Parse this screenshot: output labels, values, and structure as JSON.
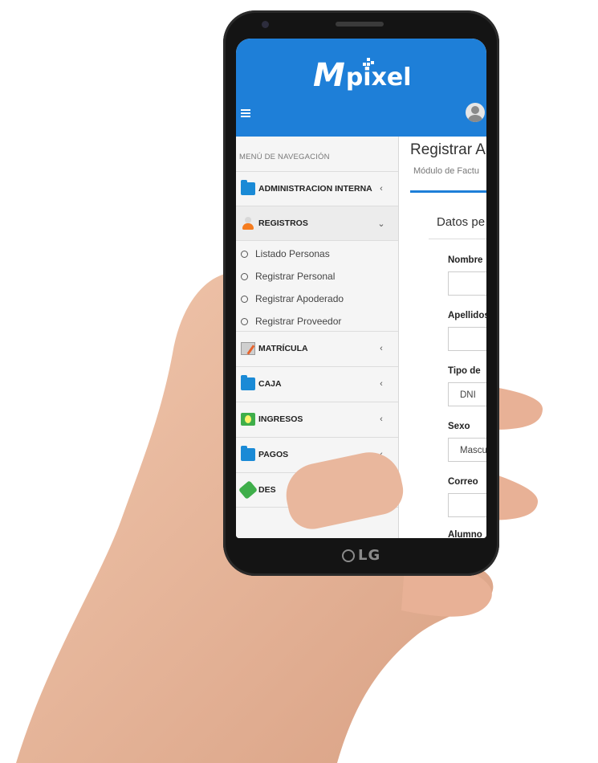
{
  "app": {
    "logo_m": "M",
    "logo_text": "pixel",
    "device_brand": "LG"
  },
  "sidebar": {
    "header": "MENÚ DE NAVEGACIÓN",
    "items": [
      {
        "label": "ADMINISTRACION INTERNA",
        "icon": "folder-icon",
        "chevron": "‹"
      },
      {
        "label": "REGISTROS",
        "icon": "person-icon",
        "chevron": "⌄",
        "expanded": true,
        "subitems": [
          "Listado Personas",
          "Registrar Personal",
          "Registrar Apoderado",
          "Registrar Proveedor"
        ]
      },
      {
        "label": "MATRÍCULA",
        "icon": "notepad-icon",
        "chevron": "‹"
      },
      {
        "label": "CAJA",
        "icon": "folder-icon",
        "chevron": "‹"
      },
      {
        "label": "INGRESOS",
        "icon": "money-icon",
        "chevron": "‹"
      },
      {
        "label": "PAGOS",
        "icon": "folder-icon",
        "chevron": "‹"
      },
      {
        "label": "DES",
        "icon": "tag-icon",
        "chevron": ""
      }
    ]
  },
  "main": {
    "title": "Registrar A",
    "subtitle": "Módulo de Factu",
    "section": "Datos pe",
    "fields": [
      {
        "label": "Nombre",
        "value": ""
      },
      {
        "label": "Apellidos",
        "value": ""
      },
      {
        "label": "Tipo de",
        "value": "DNI"
      },
      {
        "label": "Sexo",
        "value": "Mascu"
      },
      {
        "label": "Correo",
        "value": ""
      },
      {
        "label": "Alumno",
        "value": ""
      }
    ]
  },
  "colors": {
    "primary": "#1e7fd8",
    "sidebar_bg": "#f5f5f5",
    "phone_body": "#141414",
    "skin": "#e9b79d"
  }
}
